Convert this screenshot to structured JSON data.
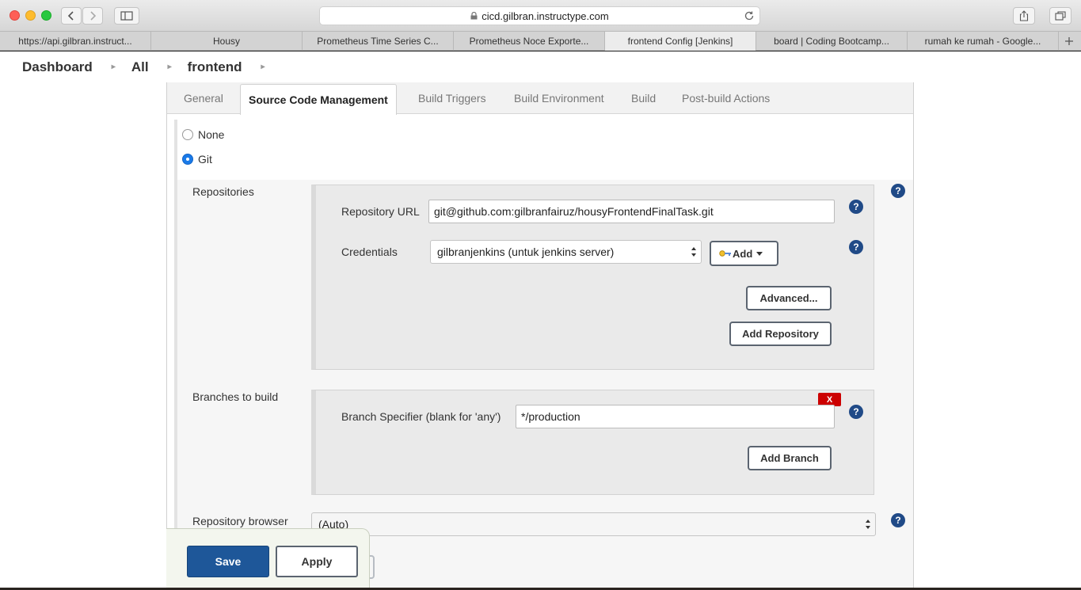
{
  "browser": {
    "url": "cicd.gilbran.instructype.com",
    "tabs": [
      {
        "label": "https://api.gilbran.instruct..."
      },
      {
        "label": "Housy"
      },
      {
        "label": "Prometheus Time Series C..."
      },
      {
        "label": "Prometheus Noce Exporte..."
      },
      {
        "label": "frontend Config [Jenkins]"
      },
      {
        "label": "board | Coding Bootcamp..."
      },
      {
        "label": "rumah ke rumah - Google..."
      }
    ]
  },
  "breadcrumb": {
    "dashboard": "Dashboard",
    "all": "All",
    "job": "frontend"
  },
  "config_tabs": {
    "general": "General",
    "scm": "Source Code Management",
    "triggers": "Build Triggers",
    "environment": "Build Environment",
    "build": "Build",
    "post_build": "Post-build Actions"
  },
  "scm": {
    "none_label": "None",
    "git_label": "Git",
    "repositories_label": "Repositories",
    "repo_url_label": "Repository URL",
    "repo_url_value": "git@github.com:gilbranfairuz/housyFrontendFinalTask.git",
    "credentials_label": "Credentials",
    "credentials_value": "gilbranjenkins (untuk jenkins server)",
    "add_label": "Add",
    "advanced_label": "Advanced...",
    "add_repository_label": "Add Repository",
    "branches_label": "Branches to build",
    "branch_spec_label": "Branch Specifier (blank for 'any')",
    "branch_spec_value": "*/production",
    "delete_label": "X",
    "add_branch_label": "Add Branch",
    "repo_browser_label": "Repository browser",
    "repo_browser_value": "(Auto)",
    "help_label": "?"
  },
  "footer": {
    "save": "Save",
    "apply": "Apply"
  },
  "colors": {
    "primary": "#1e5799",
    "help": "#204a87",
    "danger": "#cc0000"
  }
}
